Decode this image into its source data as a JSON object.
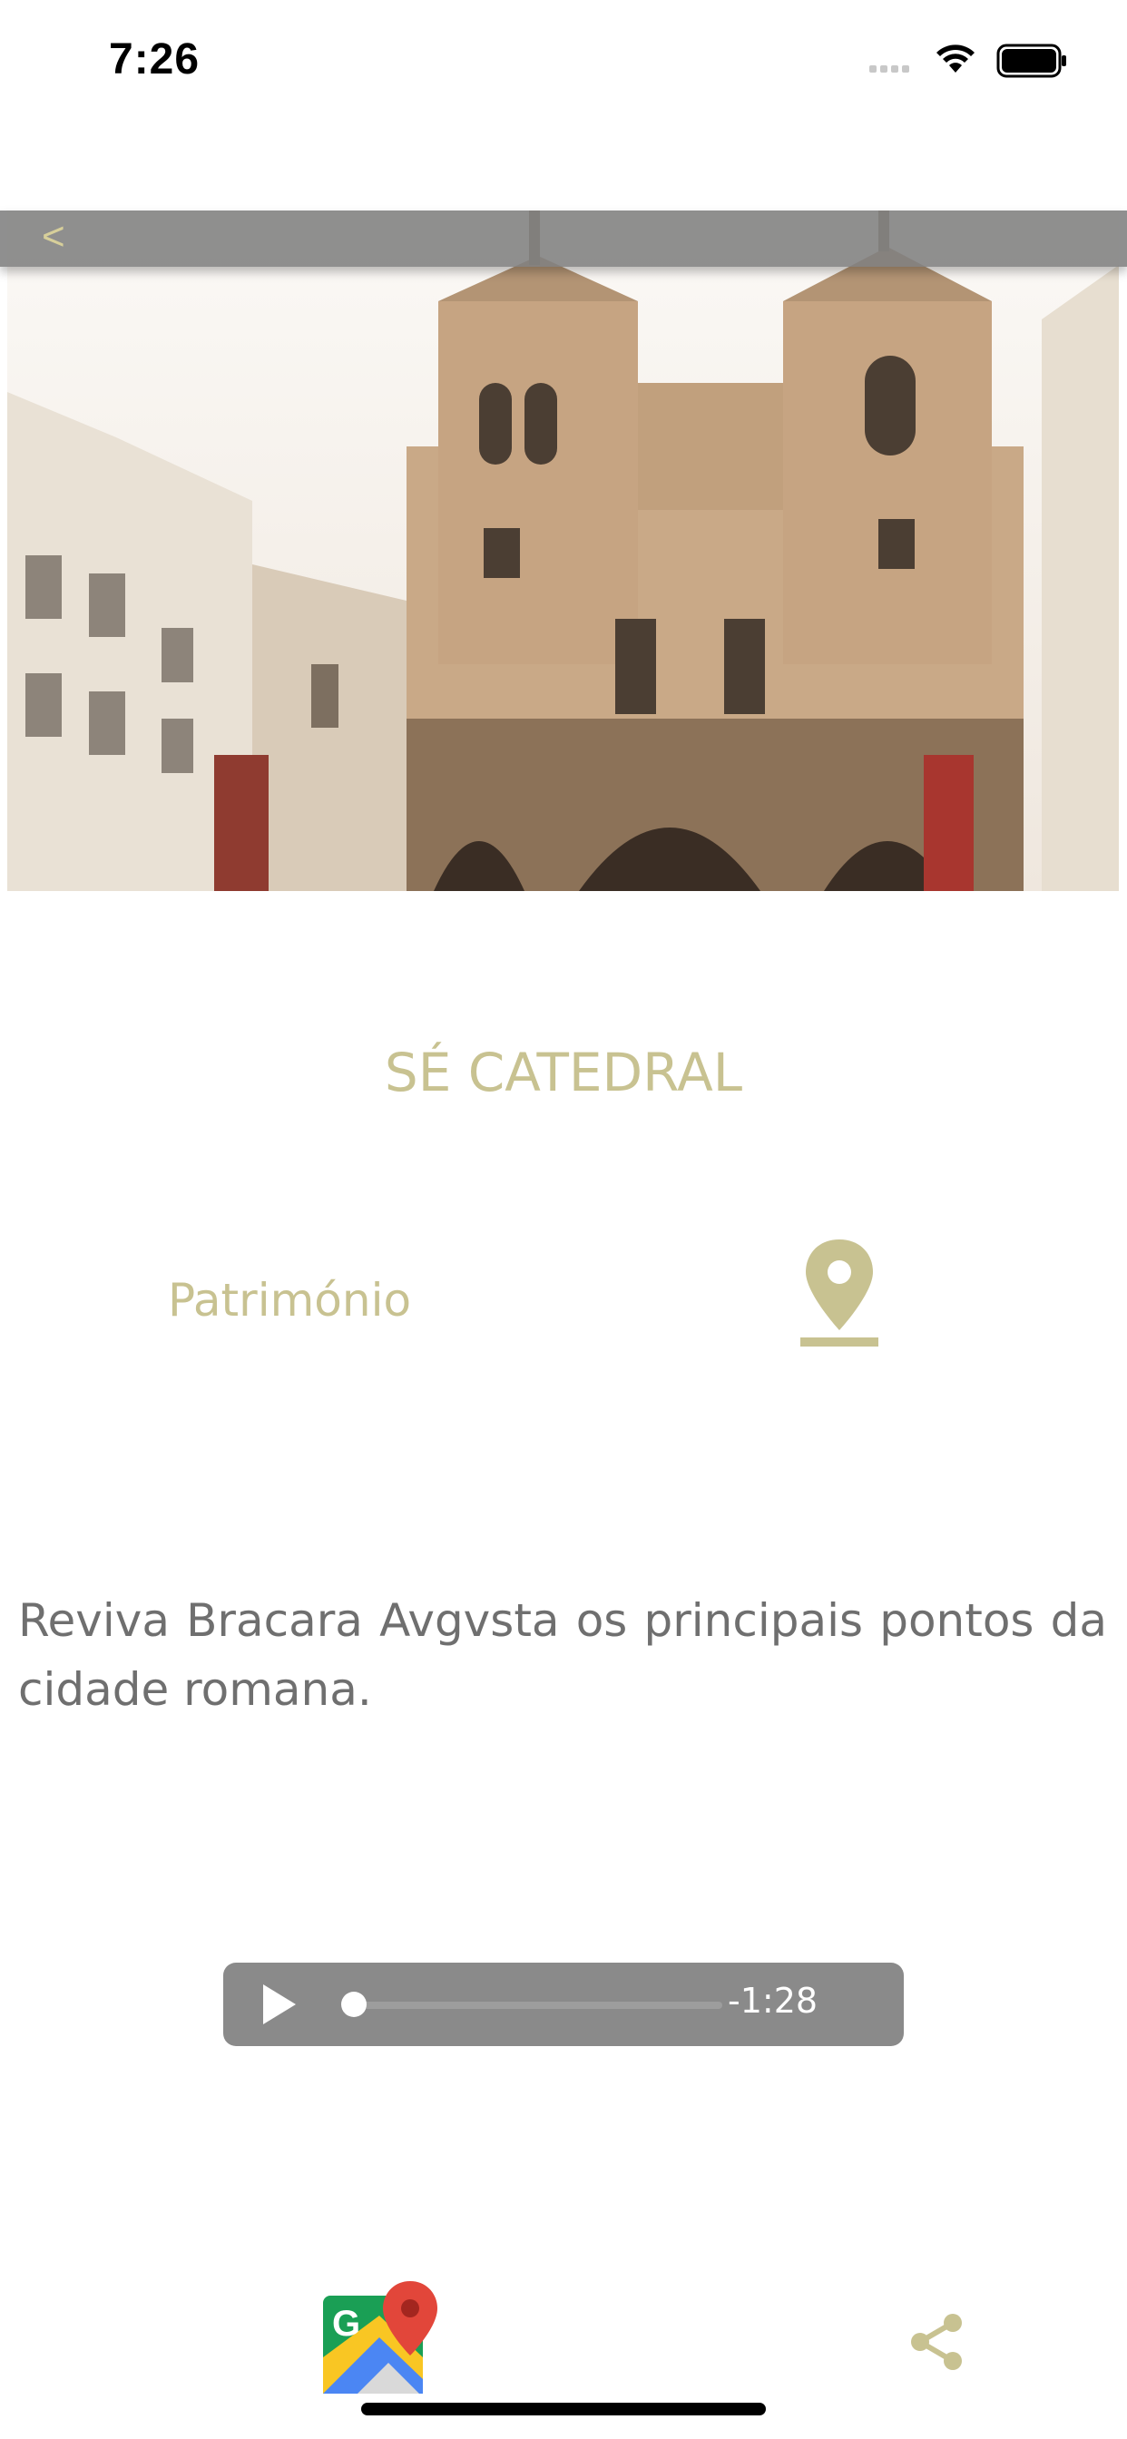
{
  "status_bar": {
    "time": "7:26"
  },
  "nav": {
    "back_label": "<"
  },
  "place": {
    "title": "SÉ CATEDRAL",
    "category": "Património",
    "description": "Reviva Bracara Avgvsta os principais pontos da cidade romana."
  },
  "audio": {
    "remaining": "-1:28",
    "progress": 0.0
  },
  "colors": {
    "accent": "#c8c291",
    "text": "#6f6f6f",
    "player": "#8a8a8a"
  },
  "icons": [
    "location-pin-icon",
    "google-maps-icon",
    "share-icon",
    "play-icon",
    "back-icon"
  ]
}
